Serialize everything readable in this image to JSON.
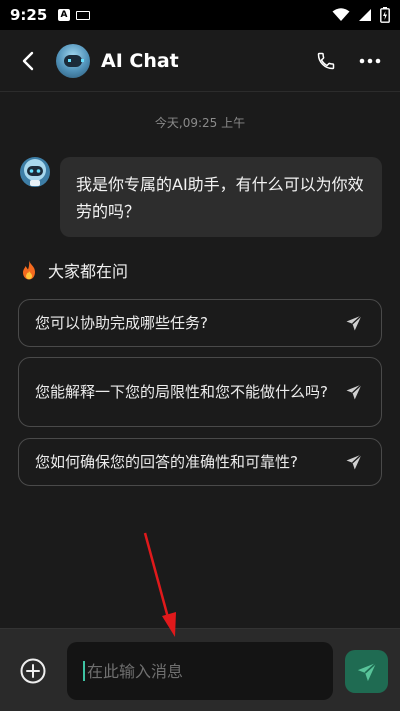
{
  "status_bar": {
    "time": "9:25",
    "icons": [
      "a-box-icon",
      "keyboard-icon",
      "wifi-icon",
      "signal-icon",
      "battery-icon"
    ]
  },
  "header": {
    "title": "AI Chat",
    "back_icon": "back-arrow-icon",
    "avatar": "robot-avatar",
    "actions": [
      "phone-icon",
      "more-icon"
    ]
  },
  "chat": {
    "timestamp": "今天,09:25 上午",
    "messages": [
      {
        "from": "ai",
        "text": "我是你专属的AI助手，有什么可以为你效劳的吗？"
      }
    ]
  },
  "suggestions": {
    "title": "大家都在问",
    "title_icon": "fire-icon",
    "questions": [
      "您可以协助完成哪些任务?",
      "您能解释一下您的局限性和您不能做什么吗?",
      "您如何确保您的回答的准确性和可靠性?"
    ]
  },
  "composer": {
    "placeholder": "在此输入消息",
    "value": "",
    "plus_icon": "add-circle-icon",
    "send_icon": "send-icon"
  },
  "colors": {
    "background": "#1b1b1b",
    "bubble": "#2d2d2d",
    "send_button": "#1f6b52",
    "send_arrow": "#58c49a",
    "annotation_arrow": "#e0191b"
  }
}
